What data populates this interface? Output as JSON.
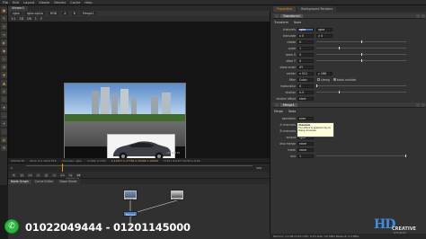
{
  "menubar": {
    "items": [
      "File",
      "Edit",
      "Layout",
      "Viewer",
      "Render",
      "Cache",
      "Help"
    ]
  },
  "viewer": {
    "tab": "Viewer1",
    "controls": [
      "rgba",
      "rgba.alpha",
      "RGB",
      "A",
      "B",
      "Merge1"
    ],
    "controls2": [
      "1:1",
      "2D",
      "f/8",
      "1",
      "Y"
    ],
    "image_labels": {
      "size": "1024x576",
      "corner": "1024x576"
    },
    "info_bar": [
      "1024x576",
      "bbox: 0 0 1024 576",
      "channels: rgba",
      "x=491 y=332",
      "0.11647 0.27766 0.50086 1.00000",
      "H:207 S:0.67 V:0.50 L:0.26"
    ]
  },
  "timeline": {
    "start": "1",
    "end": "100",
    "current": "1"
  },
  "playback": {
    "buttons": [
      "|<",
      "<<",
      "<",
      "||",
      ">",
      ">>",
      ">|"
    ],
    "fps": "24"
  },
  "nodegraph": {
    "tabs": [
      "Node Graph",
      "Curve Editor",
      "Dope Sheet"
    ],
    "active_tab": "Node Graph",
    "nodes": [
      {
        "label": "Read1"
      },
      {
        "label": "Read2"
      },
      {
        "label": "Merge1"
      }
    ]
  },
  "contact": {
    "phones": "01022049444 - 01201145000",
    "icon": "whatsapp-icon"
  },
  "properties": {
    "tabs": [
      "Properties",
      "Background Renders"
    ],
    "active_tab": "Properties",
    "transform": {
      "name": "Transform1",
      "subtabs": [
        "Transform",
        "Node"
      ],
      "rows": [
        {
          "label": "channels",
          "value": "rgba",
          "extra": "rgba"
        },
        {
          "label": "translate",
          "value": "x 0",
          "extra": "y 0"
        },
        {
          "label": "rotate",
          "value": "0"
        },
        {
          "label": "scale",
          "value": "1"
        },
        {
          "label": "skew X",
          "value": "0"
        },
        {
          "label": "skew Y",
          "value": "0"
        },
        {
          "label": "skew order",
          "value": "XY"
        },
        {
          "label": "center",
          "value": "x 512",
          "extra": "y 288"
        },
        {
          "label": "filter",
          "value": "Cubic",
          "extra": "clamp",
          "extra2": "black outside"
        },
        {
          "label": "motionblur",
          "value": "0"
        },
        {
          "label": "shutter",
          "value": "0.5"
        },
        {
          "label": "shutter offset",
          "value": "start"
        }
      ]
    },
    "merge": {
      "name": "Merge1",
      "subtabs": [
        "Merge",
        "Node"
      ],
      "rows": [
        {
          "label": "operation",
          "value": "over"
        },
        {
          "label": "A channels",
          "value": "rgba"
        },
        {
          "label": "B channels",
          "value": "rgba"
        },
        {
          "label": "output",
          "value": "rgba"
        },
        {
          "label": "also merge",
          "value": "none"
        },
        {
          "label": "mask",
          "value": "none"
        },
        {
          "label": "mix",
          "value": "1"
        }
      ]
    },
    "tooltip": {
      "title": "channels",
      "body": "The effect is applied only to these channels"
    }
  },
  "status": "Memory: 0.4 GB (2.6%)  CPU: 0.0%  Disk: 0.0 MB/s  Network: 0.0 MB/s",
  "logo": {
    "mark": "HD",
    "word": "CREATIVE",
    "sub": "STUDIO"
  }
}
